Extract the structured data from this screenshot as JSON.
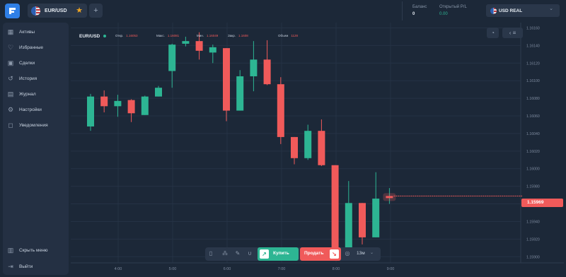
{
  "topbar": {
    "tab": {
      "label": "EUR/USD"
    },
    "plus_label": "+",
    "balance": {
      "label": "Баланс",
      "value": "0"
    },
    "pl": {
      "label": "Открытый P/L",
      "value": "0.00"
    },
    "account": {
      "label": "USD REAL"
    }
  },
  "sidebar": {
    "items": [
      {
        "label": "Активы",
        "icon": "grid-icon"
      },
      {
        "label": "Избранные",
        "icon": "heart-icon"
      },
      {
        "label": "Сделки",
        "icon": "briefcase-icon"
      },
      {
        "label": "История",
        "icon": "history-icon"
      },
      {
        "label": "Журнал",
        "icon": "book-icon"
      },
      {
        "label": "Настройки",
        "icon": "gear-icon"
      },
      {
        "label": "Уведомления",
        "icon": "bell-icon"
      }
    ],
    "bottom": [
      {
        "label": "Скрыть меню",
        "icon": "collapse-icon"
      },
      {
        "label": "Выйти",
        "icon": "logout-icon"
      }
    ]
  },
  "chart_header": {
    "pair": "EUR/USD",
    "open_label": "Откр.",
    "open": "1.16053",
    "high_label": "Макс.",
    "high": "1.16081",
    "low_label": "Мин.",
    "low": "1.16049",
    "close_label": "Закр.",
    "close": "1.1608",
    "volume_label": "Объем",
    "volume": "1128"
  },
  "current_price": "1.15969",
  "tradebar": {
    "buy_label": "Купить",
    "sell_label": "Продать",
    "timeframe": "13м"
  },
  "colors": {
    "up": "#2db593",
    "down": "#f05a5a",
    "accent": "#2f7fe6"
  },
  "chart_data": {
    "type": "candlestick",
    "x_ticks": [
      "4:00",
      "5:00",
      "6:00",
      "7:00",
      "8:00",
      "9:00"
    ],
    "y_ticks": [
      "1.16160",
      "1.16140",
      "1.16120",
      "1.16100",
      "1.16080",
      "1.16060",
      "1.16040",
      "1.16020",
      "1.16000",
      "1.15980",
      "1.15960",
      "1.15940",
      "1.15920",
      "1.15900"
    ],
    "ylim": [
      1.15893,
      1.16166
    ],
    "grid": true,
    "candles": [
      {
        "o": 1.16048,
        "h": 1.16085,
        "l": 1.16043,
        "c": 1.16082
      },
      {
        "o": 1.16082,
        "h": 1.16089,
        "l": 1.16064,
        "c": 1.16071
      },
      {
        "o": 1.16071,
        "h": 1.16084,
        "l": 1.16059,
        "c": 1.16077
      },
      {
        "o": 1.16078,
        "h": 1.16079,
        "l": 1.16053,
        "c": 1.16063
      },
      {
        "o": 1.16061,
        "h": 1.16083,
        "l": 1.16061,
        "c": 1.16082
      },
      {
        "o": 1.16082,
        "h": 1.16094,
        "l": 1.16082,
        "c": 1.16092
      },
      {
        "o": 1.16111,
        "h": 1.16142,
        "l": 1.16092,
        "c": 1.16141
      },
      {
        "o": 1.16142,
        "h": 1.1615,
        "l": 1.16139,
        "c": 1.16145
      },
      {
        "o": 1.16145,
        "h": 1.16155,
        "l": 1.16124,
        "c": 1.16134
      },
      {
        "o": 1.16132,
        "h": 1.16141,
        "l": 1.1612,
        "c": 1.16138
      },
      {
        "o": 1.16137,
        "h": 1.16137,
        "l": 1.16054,
        "c": 1.16066
      },
      {
        "o": 1.16066,
        "h": 1.16112,
        "l": 1.16066,
        "c": 1.16105
      },
      {
        "o": 1.16105,
        "h": 1.16145,
        "l": 1.16088,
        "c": 1.16124
      },
      {
        "o": 1.16124,
        "h": 1.16146,
        "l": 1.16095,
        "c": 1.16096
      },
      {
        "o": 1.16096,
        "h": 1.16104,
        "l": 1.16028,
        "c": 1.16036
      },
      {
        "o": 1.16036,
        "h": 1.16036,
        "l": 1.16005,
        "c": 1.16012
      },
      {
        "o": 1.16012,
        "h": 1.1605,
        "l": 1.1601,
        "c": 1.16043
      },
      {
        "o": 1.16043,
        "h": 1.16056,
        "l": 1.16003,
        "c": 1.16004
      },
      {
        "o": 1.16004,
        "h": 1.16004,
        "l": 1.159,
        "c": 1.159
      },
      {
        "o": 1.15904,
        "h": 1.15986,
        "l": 1.15904,
        "c": 1.15961
      },
      {
        "o": 1.15961,
        "h": 1.15961,
        "l": 1.15914,
        "c": 1.15922
      },
      {
        "o": 1.15922,
        "h": 1.15996,
        "l": 1.15922,
        "c": 1.15966
      },
      {
        "o": 1.15969,
        "h": 1.15978,
        "l": 1.1596,
        "c": 1.15969
      }
    ]
  }
}
